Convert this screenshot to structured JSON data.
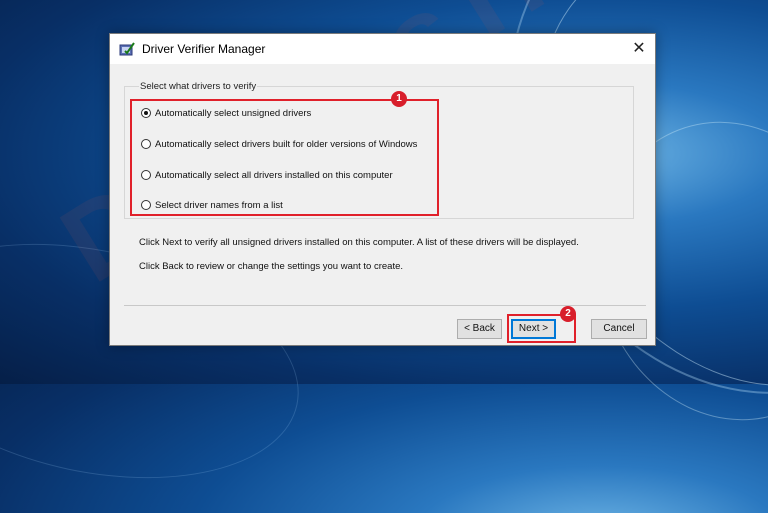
{
  "dialog": {
    "title": "Driver Verifier Manager",
    "close_glyph": "✕",
    "group_label": "Select what drivers to verify",
    "options": [
      {
        "label": "Automatically select unsigned drivers",
        "checked": true
      },
      {
        "label": "Automatically select drivers built for older versions of Windows",
        "checked": false
      },
      {
        "label": "Automatically select all drivers installed on this computer",
        "checked": false
      },
      {
        "label": "Select driver names from a list",
        "checked": false
      }
    ],
    "info_line_1": "Click Next to verify all unsigned drivers installed on this computer. A list of these drivers will be displayed.",
    "info_line_2": "Click Back to review or change the settings you want to create.",
    "buttons": {
      "back": "< Back",
      "next": "Next >",
      "cancel": "Cancel"
    }
  },
  "annotations": {
    "badge_1": "1",
    "badge_2": "2",
    "highlight_color": "#e0202a"
  },
  "background": {
    "watermark_text": "DevicesTricks"
  },
  "icons": {
    "title_icon": "driver-verifier-icon",
    "close_icon": "close-icon"
  }
}
